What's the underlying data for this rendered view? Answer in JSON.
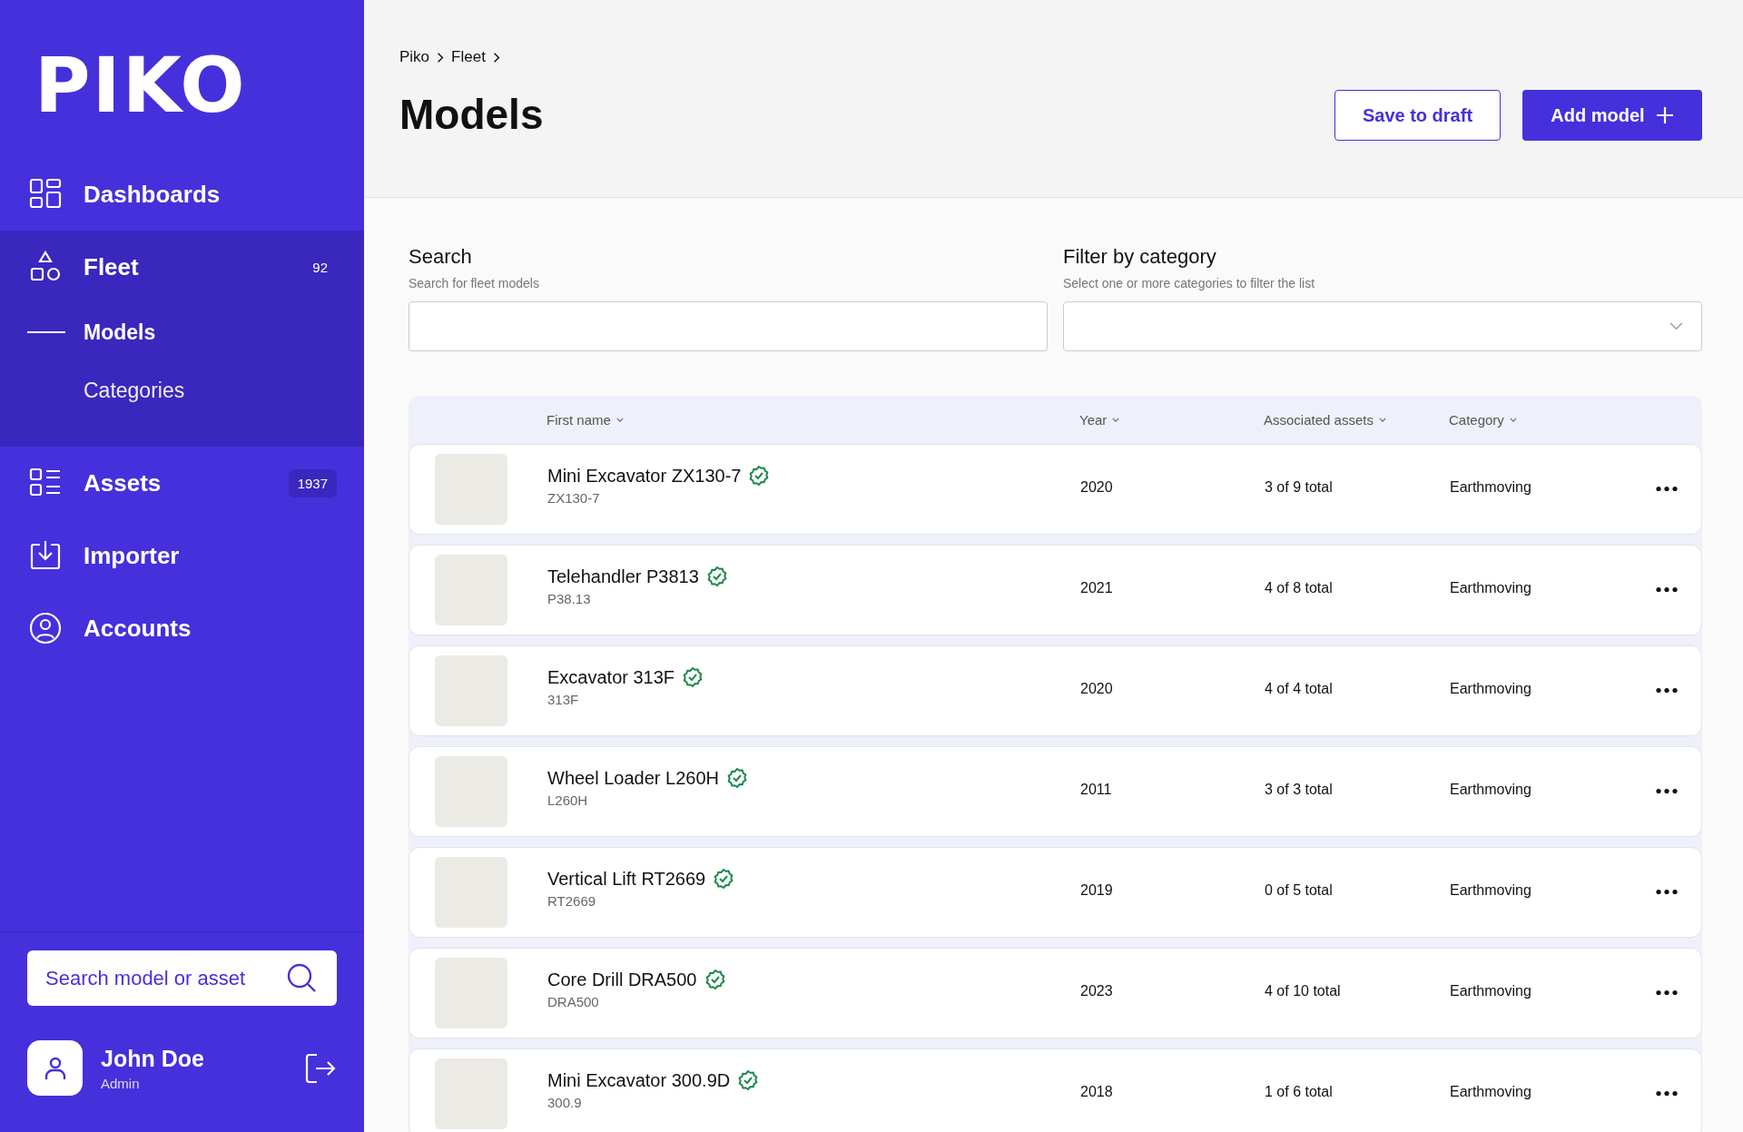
{
  "sidebar": {
    "logo": "PIKO",
    "nav": [
      {
        "kind": "dashboards",
        "label": "Dashboards",
        "expanded": false
      },
      {
        "kind": "fleet",
        "label": "Fleet",
        "badge": "92",
        "expanded": true,
        "children": [
          {
            "label": "Models",
            "selected": true
          },
          {
            "label": "Categories",
            "selected": false
          }
        ]
      },
      {
        "kind": "assets",
        "label": "Assets",
        "badge": "1937",
        "expanded": false
      },
      {
        "kind": "importer",
        "label": "Importer",
        "expanded": false
      },
      {
        "kind": "accounts",
        "label": "Accounts",
        "expanded": false
      }
    ],
    "search": {
      "placeholder": "Search model or asset"
    },
    "user": {
      "name": "John Doe",
      "role": "Admin"
    }
  },
  "breadcrumb": [
    "Piko",
    "Fleet"
  ],
  "title": "Models",
  "buttons": [
    {
      "kind": "secondary",
      "label": "Save to draft"
    },
    {
      "kind": "primary",
      "label": "Add model"
    }
  ],
  "filters": [
    {
      "kind": "text",
      "label": "Search",
      "hint": "Search for fleet models"
    },
    {
      "kind": "select",
      "label": "Filter by category",
      "hint": "Select one or more categories to filter the list"
    }
  ],
  "table": {
    "columns": [
      "First name",
      "Year",
      "Associated assets",
      "Category"
    ],
    "rows": [
      {
        "name": "Mini Excavator ZX130-7",
        "code": "ZX130-7",
        "verified": true,
        "year": "2020",
        "assets": "3 of 9 total",
        "category": "Earthmoving"
      },
      {
        "name": "Telehandler P3813",
        "code": "P38.13",
        "verified": true,
        "year": "2021",
        "assets": "4 of 8 total",
        "category": "Earthmoving"
      },
      {
        "name": "Excavator 313F",
        "code": "313F",
        "verified": true,
        "year": "2020",
        "assets": "4 of 4 total",
        "category": "Earthmoving"
      },
      {
        "name": "Wheel Loader L260H",
        "code": "L260H",
        "verified": true,
        "year": "2011",
        "assets": "3 of 3 total",
        "category": "Earthmoving"
      },
      {
        "name": "Vertical Lift RT2669",
        "code": "RT2669",
        "verified": true,
        "year": "2019",
        "assets": "0 of 5 total",
        "category": "Earthmoving"
      },
      {
        "name": "Core Drill DRA500",
        "code": "DRA500",
        "verified": true,
        "year": "2023",
        "assets": "4 of 10 total",
        "category": "Earthmoving"
      },
      {
        "name": "Mini Excavator 300.9D",
        "code": "300.9",
        "verified": true,
        "year": "2018",
        "assets": "1 of 6 total",
        "category": "Earthmoving"
      }
    ]
  }
}
